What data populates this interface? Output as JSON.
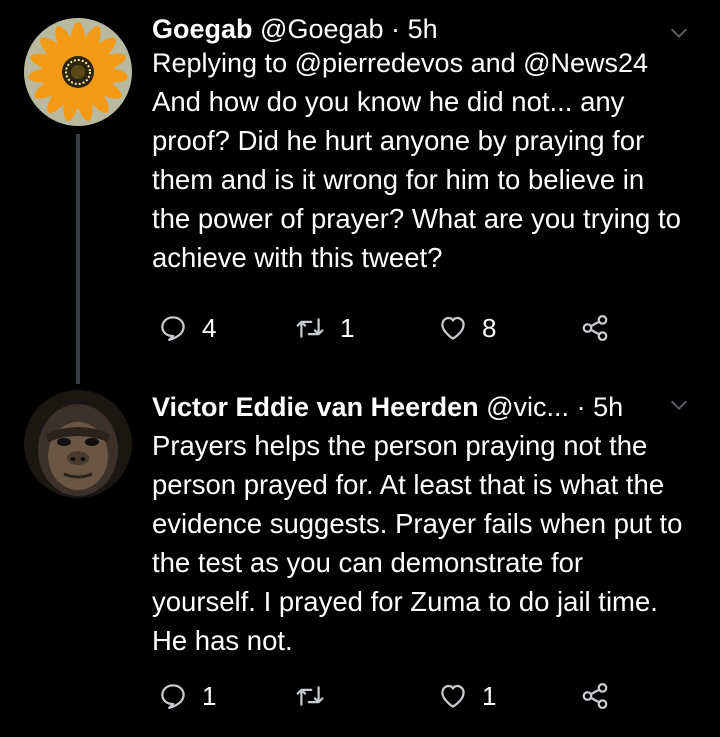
{
  "tweets": [
    {
      "name": "Goegab",
      "handle": "@Goegab",
      "separator": "·",
      "time": "5h",
      "replying_to": "Replying to @pierredevos and @News24",
      "text": "And how do you know he did not... any proof? Did he hurt anyone by praying for them and is it wrong for him to believe in the power of prayer? What are you trying to achieve with this tweet?",
      "replies": "4",
      "retweets": "1",
      "likes": "8",
      "avatar_icon": "sunflower-avatar"
    },
    {
      "name": "Victor Eddie van Heerden",
      "handle": "@vic...",
      "separator": "·",
      "time": "5h",
      "text": "Prayers helps the person praying not the person prayed for. At least that is what the evidence suggests. Prayer fails when put to the test as you can demonstrate for yourself. I prayed for Zuma to do jail time. He has not.",
      "replies": "1",
      "retweets": "",
      "likes": "1",
      "avatar_icon": "ape-avatar"
    }
  ],
  "colors": {
    "background": "#000000",
    "text": "#ffffff",
    "icon": "#c8ccd0",
    "thread_line": "#3a3d41"
  }
}
